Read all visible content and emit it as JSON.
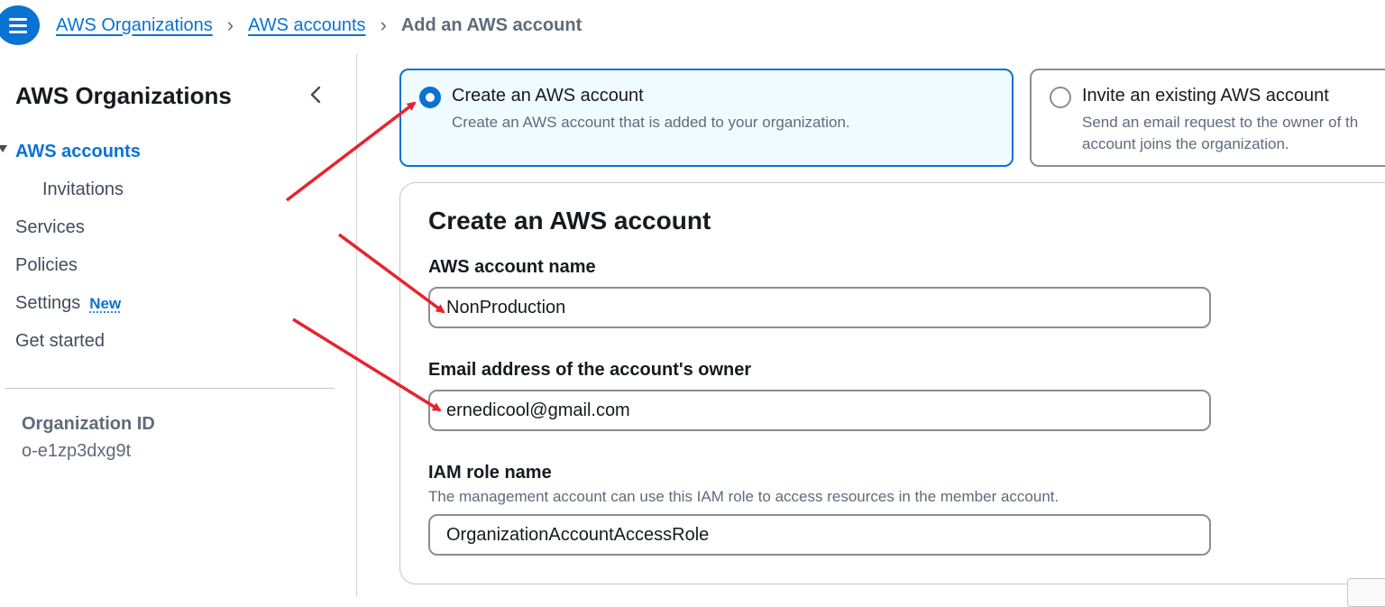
{
  "breadcrumb": {
    "items": [
      "AWS Organizations",
      "AWS accounts"
    ],
    "current": "Add an AWS account"
  },
  "sidebar": {
    "title": "AWS Organizations",
    "items": [
      {
        "label": "AWS accounts",
        "active": true
      },
      {
        "label": "Invitations"
      },
      {
        "label": "Services"
      },
      {
        "label": "Policies"
      },
      {
        "label": "Settings",
        "badge": "New"
      },
      {
        "label": "Get started"
      }
    ],
    "org_id_label": "Organization ID",
    "org_id_value": "o-e1zp3dxg9t"
  },
  "options": [
    {
      "title": "Create an AWS account",
      "description": "Create an AWS account that is added to your organization.",
      "selected": true
    },
    {
      "title": "Invite an existing AWS account",
      "description": "Send an email request to the owner of th account joins the organization.",
      "selected": false
    }
  ],
  "form": {
    "title": "Create an AWS account",
    "account_name": {
      "label": "AWS account name",
      "value": "NonProduction"
    },
    "email": {
      "label": "Email address of the account's owner",
      "value": "ernedicool@gmail.com"
    },
    "iam_role": {
      "label": "IAM role name",
      "description": "The management account can use this IAM role to access resources in the member account.",
      "value": "OrganizationAccountAccessRole"
    }
  },
  "colors": {
    "accent": "#0972d3",
    "annotation": "#e8232d",
    "tile_selected_bg": "#f0fbff"
  },
  "icons": [
    "menu-icon",
    "chevron-right-icon",
    "chevron-left-icon",
    "caret-down-icon",
    "radio-icon"
  ]
}
